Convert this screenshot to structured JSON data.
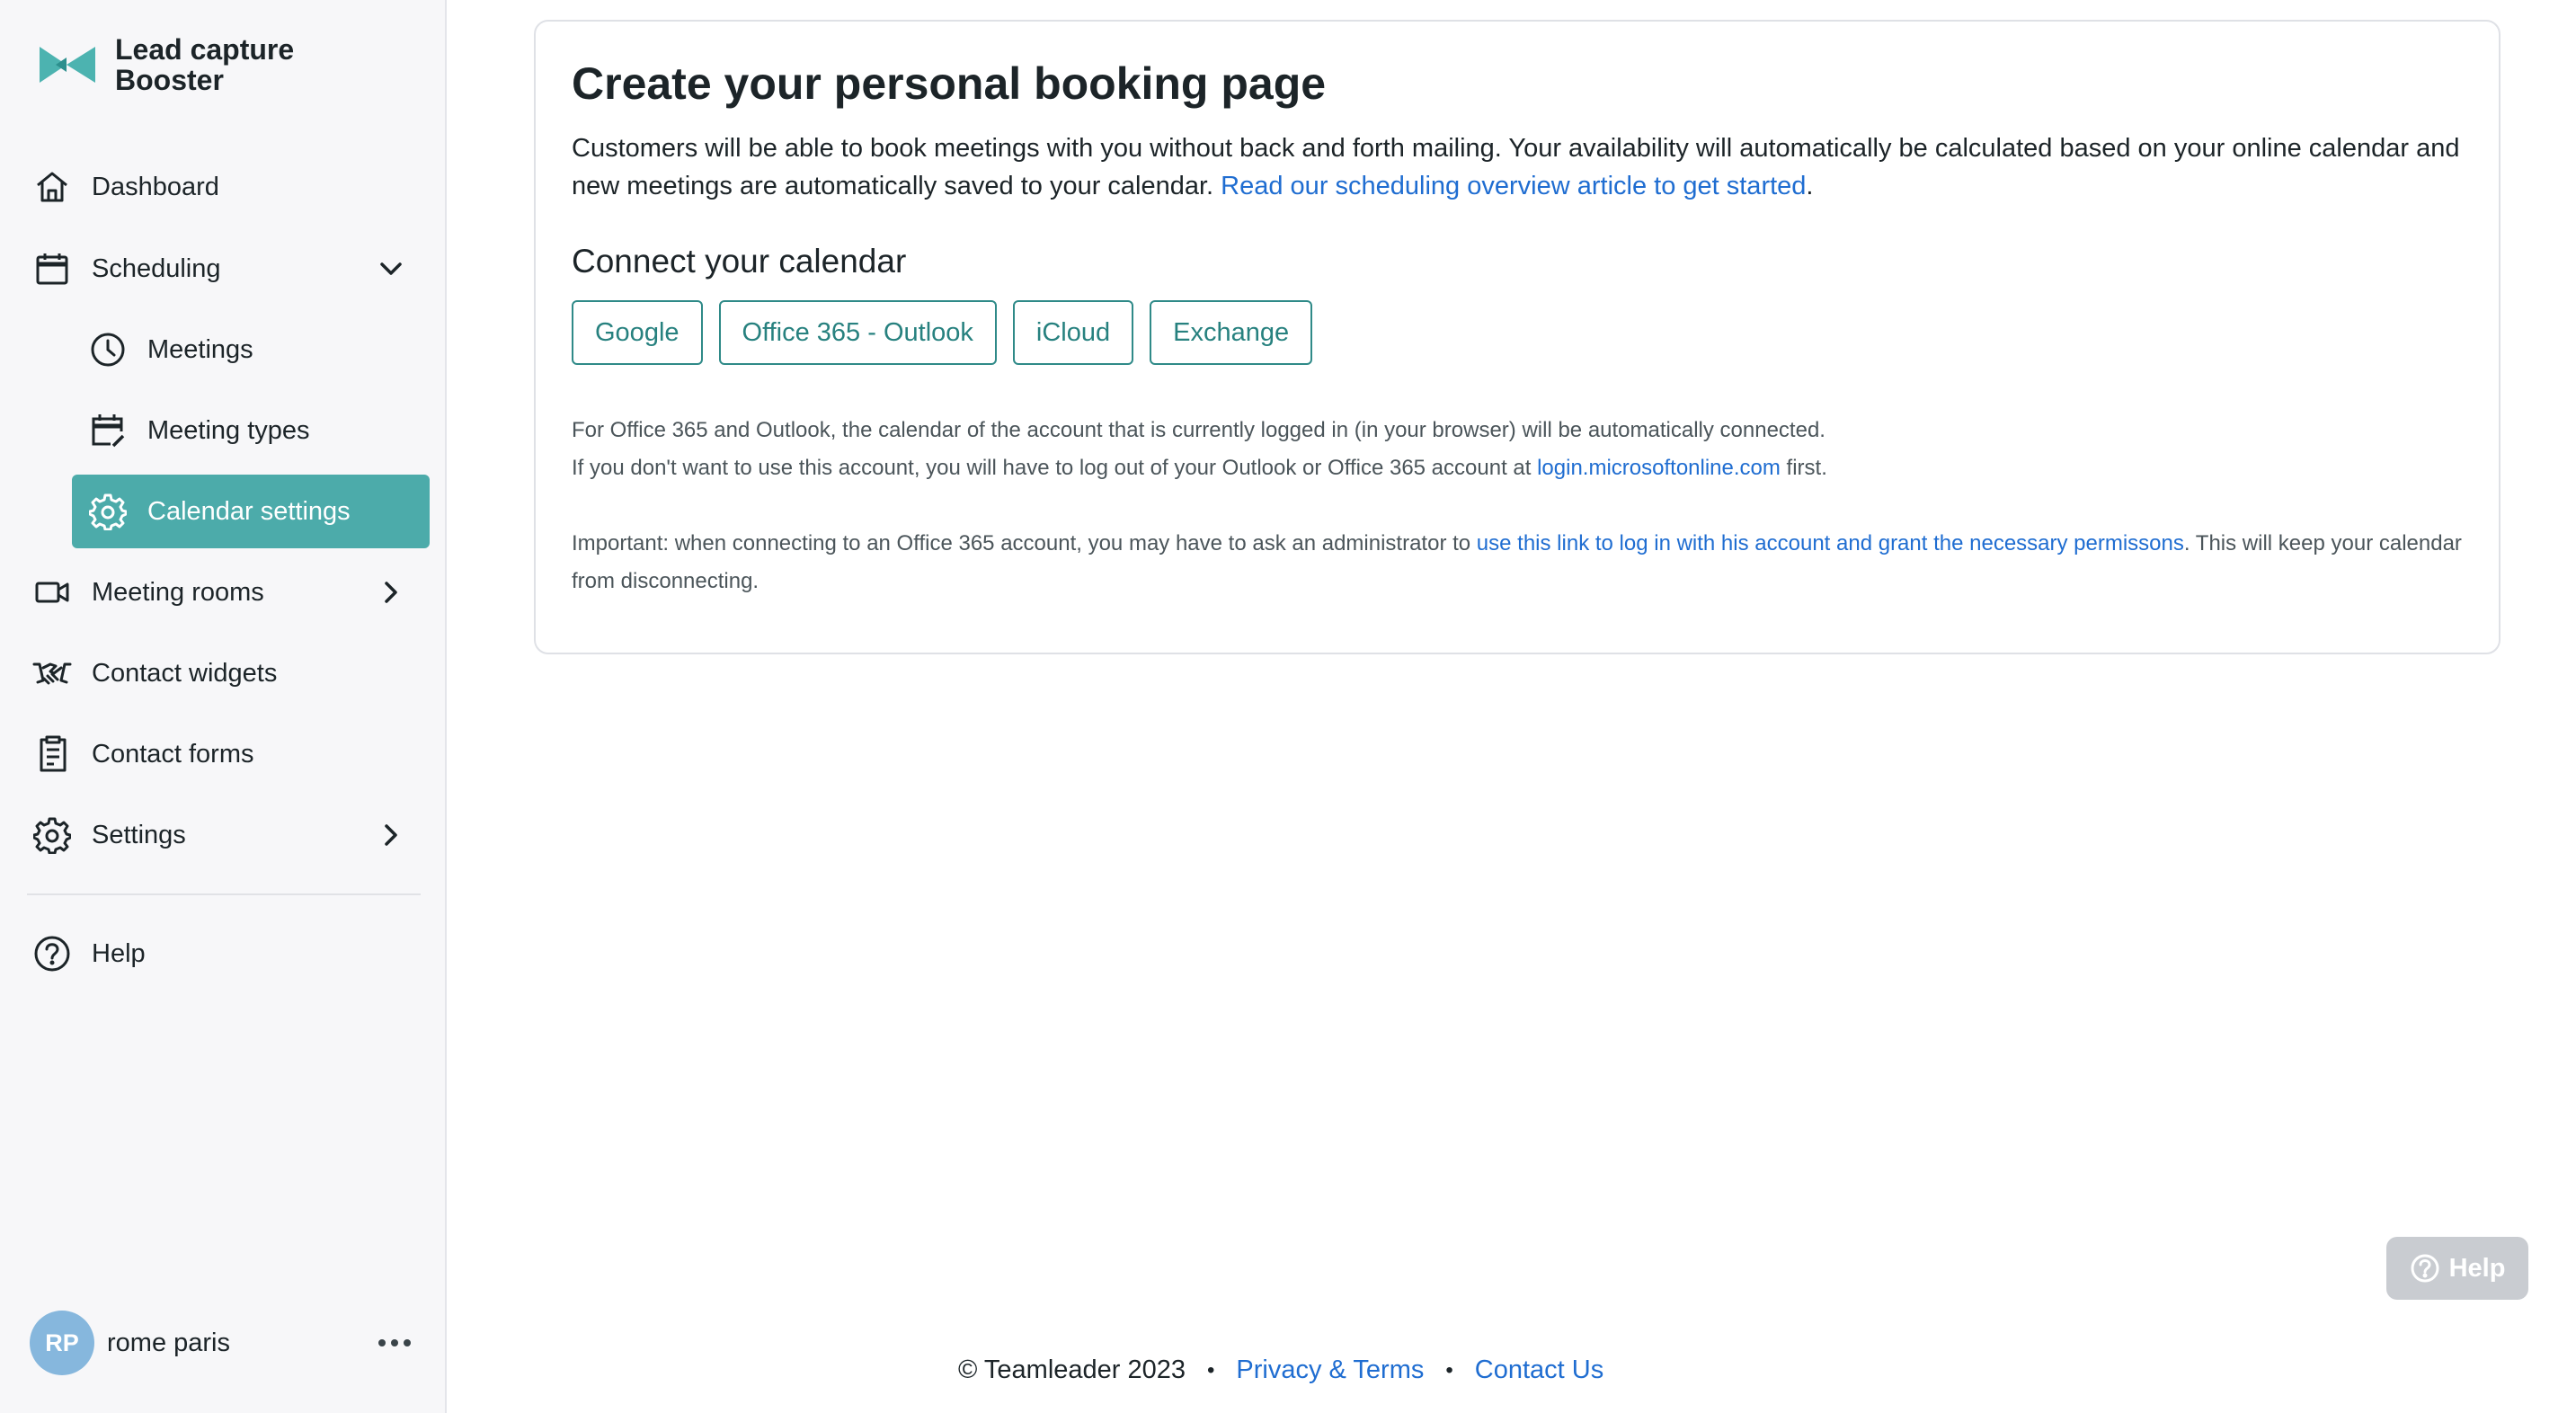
{
  "brand": {
    "line1": "Lead capture",
    "line2": "Booster"
  },
  "sidebar": {
    "items": [
      {
        "label": "Dashboard",
        "icon": "home-icon"
      },
      {
        "label": "Scheduling",
        "icon": "calendar-icon",
        "expanded": true
      },
      {
        "label": "Meetings",
        "icon": "clock-icon"
      },
      {
        "label": "Meeting types",
        "icon": "calendar-edit-icon"
      },
      {
        "label": "Calendar settings",
        "icon": "gear-icon",
        "active": true
      },
      {
        "label": "Meeting rooms",
        "icon": "video-icon"
      },
      {
        "label": "Contact widgets",
        "icon": "handshake-icon"
      },
      {
        "label": "Contact forms",
        "icon": "form-icon"
      },
      {
        "label": "Settings",
        "icon": "gear-icon"
      },
      {
        "label": "Help",
        "icon": "help-circle-icon"
      }
    ],
    "accent": "#4cabaa"
  },
  "user": {
    "initials": "RP",
    "name": "rome paris",
    "avatar_color": "#86b7dd"
  },
  "main": {
    "title": "Create your personal booking page",
    "desc_text": "Customers will be able to book meetings with you without back and forth mailing. Your availability will automatically be calculated based on your online calendar and new meetings are automatically saved to your calendar. ",
    "desc_link": "Read our scheduling overview article to get started",
    "desc_end": ".",
    "connect_title": "Connect your calendar",
    "buttons": [
      "Google",
      "Office 365 - Outlook",
      "iCloud",
      "Exchange"
    ],
    "note1_line1": "For Office 365 and Outlook, the calendar of the account that is currently logged in (in your browser) will be automatically connected.",
    "note1_line2_pre": "If you don't want to use this account, you will have to log out of your Outlook or Office 365 account at ",
    "note1_link": "login.microsoftonline.com",
    "note1_line2_post": " first.",
    "note2_pre": "Important: when connecting to an Office 365 account, you may have to ask an administrator to ",
    "note2_link": "use this link to log in with his account and grant the necessary permissons",
    "note2_post": ". This will keep your calendar from disconnecting."
  },
  "help_float": {
    "label": "Help"
  },
  "footer": {
    "copyright": "© Teamleader 2023",
    "privacy": "Privacy & Terms",
    "contact": "Contact Us"
  }
}
